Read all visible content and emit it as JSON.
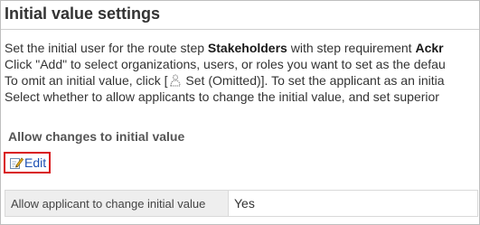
{
  "page": {
    "title": "Initial value settings"
  },
  "description": {
    "line1_prefix": "Set the initial user for the route step ",
    "line1_step": "Stakeholders",
    "line1_mid": " with step requirement ",
    "line1_requirement": "Ackr",
    "line2": "Click \"Add\" to select organizations, users, or roles you want to set as the defau",
    "line3_before_icon": "To omit an initial value, click [",
    "line3_after_icon": " Set (Omitted)]. To set the applicant as an initia",
    "line4": "Select whether to allow applicants to change the initial value, and set superior"
  },
  "section": {
    "heading": "Allow changes to initial value",
    "edit_label": "Edit"
  },
  "settings_table": {
    "label": "Allow applicant to change initial value",
    "value": "Yes"
  },
  "icons": {
    "set_omitted": "person-dotted-icon",
    "edit": "edit-pencil-icon"
  },
  "colors": {
    "link": "#1e50b4",
    "highlight_border": "#d9161a",
    "label_cell_bg": "#eeeeee"
  }
}
